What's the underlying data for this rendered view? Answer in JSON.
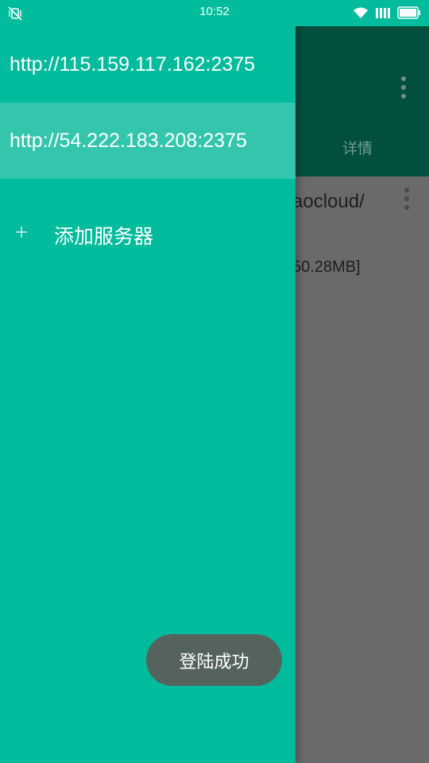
{
  "status_bar": {
    "time": "10:52",
    "icons": [
      "vibrate-off-icon",
      "wifi-icon",
      "signal-icon",
      "battery-icon"
    ]
  },
  "background": {
    "tab_label": "详情",
    "item_title": "aocloud/",
    "item_size": "50.28MB]"
  },
  "drawer": {
    "servers": [
      {
        "label": "http://115.159.117.162:2375",
        "selected": false
      },
      {
        "label": "http://54.222.183.208:2375",
        "selected": true
      }
    ],
    "add_server_label": "添加服务器"
  },
  "toast": {
    "message": "登陆成功"
  },
  "colors": {
    "accent": "#00bb9c",
    "selected_row": "#34c6ac",
    "toolbar_dark": "#004f3f",
    "scrim": "#6a6a6a",
    "toast_bg": "#55635d"
  }
}
